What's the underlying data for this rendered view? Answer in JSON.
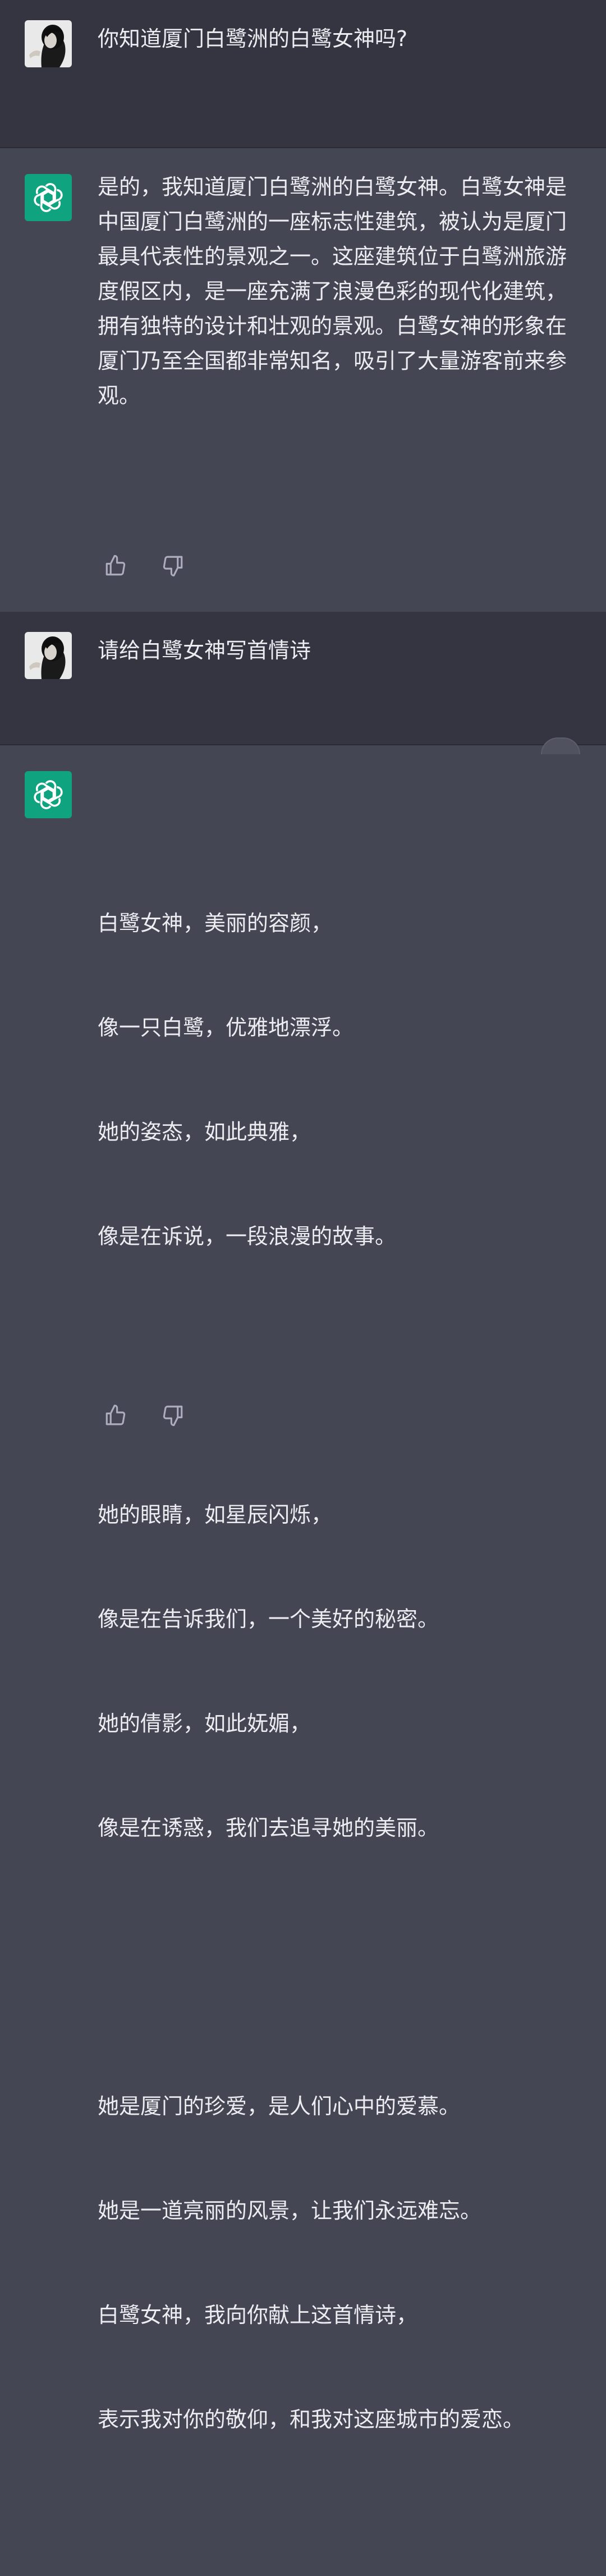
{
  "conversation": [
    {
      "role": "user",
      "avatar_icon": "user-avatar-photo",
      "text": "你知道厦门白鹭洲的白鹭女神吗?"
    },
    {
      "role": "assistant",
      "avatar_icon": "openai-logo-icon",
      "text": "是的，我知道厦门白鹭洲的白鹭女神。白鹭女神是中国厦门白鹭洲的一座标志性建筑，被认为是厦门最具代表性的景观之一。这座建筑位于白鹭洲旅游度假区内，是一座充满了浪漫色彩的现代化建筑，拥有独特的设计和壮观的景观。白鹭女神的形象在厦门乃至全国都非常知名，吸引了大量游客前来参观。"
    },
    {
      "role": "user",
      "avatar_icon": "user-avatar-photo",
      "text": "请给白鹭女神写首情诗"
    },
    {
      "role": "assistant",
      "avatar_icon": "openai-logo-icon",
      "stanzas": [
        [
          "白鹭女神，美丽的容颜，",
          "像一只白鹭，优雅地漂浮。",
          "她的姿态，如此典雅，",
          "像是在诉说，一段浪漫的故事。"
        ],
        [
          "她的眼睛，如星辰闪烁，",
          "像是在告诉我们，一个美好的秘密。",
          "她的倩影，如此妩媚，",
          "像是在诱惑，我们去追寻她的美丽。"
        ],
        [
          "她是厦门的珍爱，是人们心中的爱慕。",
          "她是一道亮丽的风景，让我们永远难忘。",
          "白鹭女神，我向你献上这首情诗，",
          "表示我对你的敬仰，和我对这座城市的爱恋。"
        ]
      ]
    }
  ],
  "actions": {
    "thumbs_up_icon": "thumbs-up-icon",
    "thumbs_down_icon": "thumbs-down-icon"
  },
  "colors": {
    "user_bg": "#343541",
    "assistant_bg": "#444654",
    "text": "#ececf1",
    "openai_green": "#10a37f",
    "icon": "#acacbe"
  }
}
